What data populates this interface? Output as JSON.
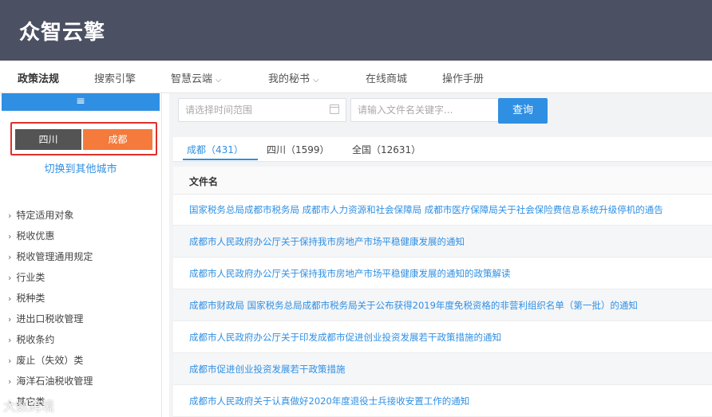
{
  "header": {
    "logo": "众智云擎"
  },
  "nav": {
    "items": [
      {
        "label": "政策法规",
        "dropdown": false,
        "active": true
      },
      {
        "label": "搜索引擎",
        "dropdown": false
      },
      {
        "label": "智慧云端",
        "dropdown": true
      },
      {
        "label": "我的秘书",
        "dropdown": true
      },
      {
        "label": "在线商城",
        "dropdown": false
      },
      {
        "label": "操作手册",
        "dropdown": false
      }
    ],
    "dropdown_icon": "chevron-down-icon"
  },
  "sidebar": {
    "toggle_icon": "menu-icon",
    "toggle_glyph": "≡",
    "region_province": "四川",
    "region_city": "成都",
    "switch_city": "切换到其他城市",
    "categories": [
      "特定适用对象",
      "税收优惠",
      "税收管理通用规定",
      "行业类",
      "税种类",
      "进出口税收管理",
      "税收条约",
      "废止（失效）类",
      "海洋石油税收管理",
      "其它类"
    ]
  },
  "search": {
    "date_placeholder": "请选择时间范围",
    "keyword_placeholder": "请输入文件名关键字...",
    "button": "查询"
  },
  "tabs": [
    {
      "label": "成都（431）",
      "active": true
    },
    {
      "label": "四川（1599）"
    },
    {
      "label": "全国（12631）"
    }
  ],
  "table": {
    "header": "文件名",
    "rows": [
      "国家税务总局成都市税务局 成都市人力资源和社会保障局 成都市医疗保障局关于社会保险费信息系统升级停机的通告",
      "成都市人民政府办公厅关于保持我市房地产市场平稳健康发展的通知",
      "成都市人民政府办公厅关于保持我市房地产市场平稳健康发展的通知的政策解读",
      "成都市财政局 国家税务总局成都市税务局关于公布获得2019年度免税资格的非营利组织名单（第一批）的通知",
      "成都市人民政府办公厅关于印发成都市促进创业投资发展若干政策措施的通知",
      "成都市促进创业投资发展若干政策措施",
      "成都市人民政府关于认真做好2020年度退役士兵接收安置工作的通知"
    ]
  },
  "watermark": "大数跨境",
  "colors": {
    "header_bg": "#4b5062",
    "accent": "#2f8fe3",
    "city_button": "#f47b3c",
    "province_button": "#545454",
    "highlight_border": "#e0302a"
  }
}
